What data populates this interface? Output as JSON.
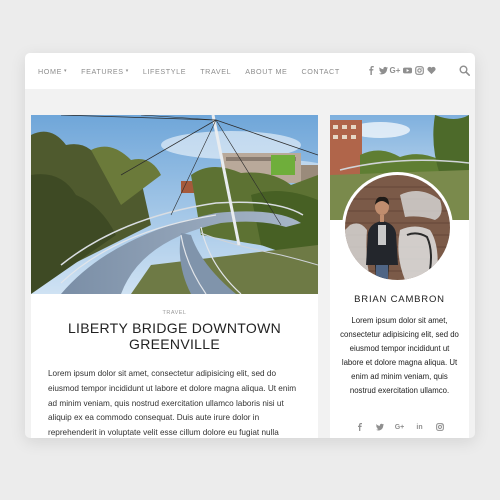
{
  "nav": {
    "items": [
      {
        "label": "HOME",
        "caret": "▾"
      },
      {
        "label": "FEATURES",
        "caret": "▾"
      },
      {
        "label": "LIFESTYLE",
        "caret": ""
      },
      {
        "label": "TRAVEL",
        "caret": ""
      },
      {
        "label": "ABOUT ME",
        "caret": ""
      },
      {
        "label": "CONTACT",
        "caret": ""
      }
    ],
    "social_icons": [
      "facebook-icon",
      "twitter-icon",
      "google-plus-icon",
      "youtube-icon",
      "instagram-icon",
      "heart-icon"
    ],
    "google_plus_label": "G+"
  },
  "post": {
    "category": "TRAVEL",
    "title": "LIBERTY BRIDGE DOWNTOWN GREENVILLE",
    "excerpt": "Lorem ipsum dolor sit amet, consectetur adipisicing elit, sed do eiusmod tempor incididunt ut labore et dolore magna aliqua. Ut enim ad minim veniam, quis nostrud exercitation ullamco laboris nisi ut aliquip ex ea commodo consequat. Duis aute irure dolor in reprehenderit in voluptate velit esse cillum dolore eu fugiat nulla"
  },
  "author": {
    "name": "BRIAN CAMBRON",
    "bio": "Lorem ipsum dolor sit amet, consectetur adipisicing elit, sed do eiusmod tempor incididunt ut labore et dolore magna aliqua. Ut enim ad minim veniam, quis nostrud exercitation ullamco.",
    "social_icons": [
      "facebook-icon",
      "twitter-icon",
      "google-plus-icon",
      "linkedin-icon",
      "instagram-icon"
    ],
    "google_plus_label": "G+",
    "linkedin_label": "in"
  },
  "colors": {
    "nav_text": "#8d8d8d",
    "title_text": "#222222",
    "page_background": "#ececec"
  }
}
